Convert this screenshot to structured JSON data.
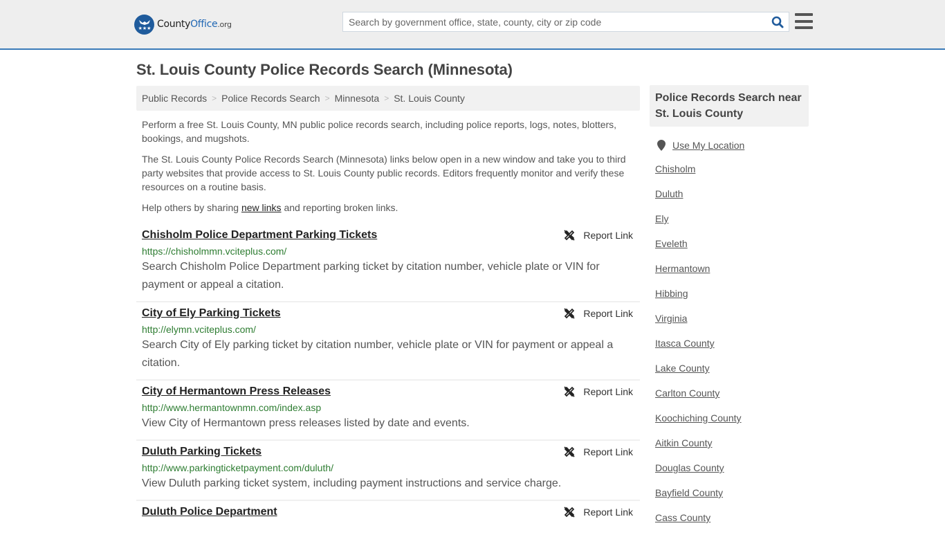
{
  "header": {
    "logo": {
      "name": "County",
      "brand": "Office",
      "tld": ".org"
    },
    "search": {
      "placeholder": "Search by government office, state, county, city or zip code",
      "value": ""
    },
    "accent_color": "#3a7ab8"
  },
  "page": {
    "title": "St. Louis County Police Records Search (Minnesota)",
    "breadcrumb": [
      {
        "label": "Public Records"
      },
      {
        "label": "Police Records Search"
      },
      {
        "label": "Minnesota"
      },
      {
        "label": "St. Louis County"
      }
    ],
    "separator": ">",
    "intro": {
      "p1": "Perform a free St. Louis County, MN public police records search, including police reports, logs, notes, blotters, bookings, and mugshots.",
      "p2": "The St. Louis County Police Records Search (Minnesota) links below open in a new window and take you to third party websites that provide access to St. Louis County public records. Editors frequently monitor and verify these resources on a routine basis.",
      "p3_before": "Help others by sharing ",
      "p3_link": "new links",
      "p3_after": " and reporting broken links."
    }
  },
  "results": [
    {
      "title": "Chisholm Police Department Parking Tickets",
      "url": "https://chisholmmn.vciteplus.com/",
      "description": "Search Chisholm Police Department parking ticket by citation number, vehicle plate or VIN for payment or appeal a citation.",
      "report_label": "Report Link"
    },
    {
      "title": "City of Ely Parking Tickets",
      "url": "http://elymn.vciteplus.com/",
      "description": "Search City of Ely parking ticket by citation number, vehicle plate or VIN for payment or appeal a citation.",
      "report_label": "Report Link"
    },
    {
      "title": "City of Hermantown Press Releases",
      "url": "http://www.hermantownmn.com/index.asp",
      "description": "View City of Hermantown press releases listed by date and events.",
      "report_label": "Report Link"
    },
    {
      "title": "Duluth Parking Tickets",
      "url": "http://www.parkingticketpayment.com/duluth/",
      "description": "View Duluth parking ticket system, including payment instructions and service charge.",
      "report_label": "Report Link"
    },
    {
      "title": "Duluth Police Department",
      "url": "",
      "description": "",
      "report_label": "Report Link"
    }
  ],
  "sidebar": {
    "heading": "Police Records Search near St. Louis County",
    "use_location": "Use My Location",
    "links": [
      "Chisholm",
      "Duluth",
      "Ely",
      "Eveleth",
      "Hermantown",
      "Hibbing",
      "Virginia",
      "Itasca County",
      "Lake County",
      "Carlton County",
      "Koochiching County",
      "Aitkin County",
      "Douglas County",
      "Bayfield County",
      "Cass County"
    ]
  }
}
